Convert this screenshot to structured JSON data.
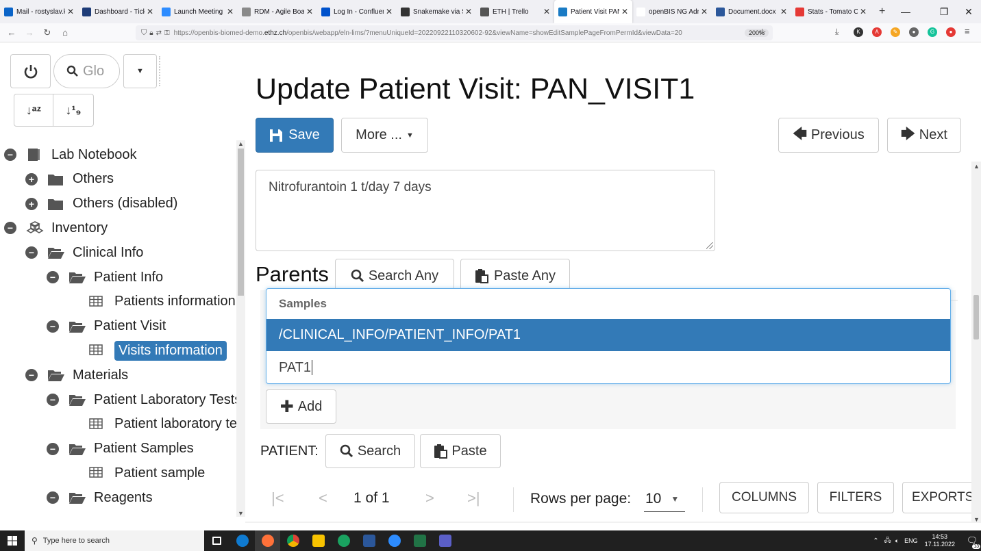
{
  "browser": {
    "tabs": [
      {
        "label": "Mail - rostyslav.ku",
        "color": "#0a64c8"
      },
      {
        "label": "Dashboard - Ticket",
        "color": "#1e3c78"
      },
      {
        "label": "Launch Meeting -",
        "color": "#2d8cff"
      },
      {
        "label": "RDM - Agile Board",
        "color": "#8a8a8a"
      },
      {
        "label": "Log In - Confluenc",
        "color": "#0052cc"
      },
      {
        "label": "Snakemake via SLU",
        "color": "#333333"
      },
      {
        "label": "ETH | Trello",
        "color": "#555555"
      },
      {
        "label": "Patient Visit PAN_V",
        "color": "#1a7bc4"
      },
      {
        "label": "openBIS NG Admin",
        "color": "#ffffff"
      },
      {
        "label": "Document.docx",
        "color": "#2b579a"
      },
      {
        "label": "Stats - Tomato Clo",
        "color": "#e53935"
      }
    ],
    "url_prefix": "https://openbis-biomed-demo.",
    "url_domain": "ethz.ch",
    "url_suffix": "/openbis/webapp/eln-lims/?menuUniqueId=20220922110320602-92&viewName=showEditSamplePageFromPermId&viewData=20",
    "zoom": "200%"
  },
  "left": {
    "search_placeholder": "Glo",
    "tree": [
      {
        "label": "Lab Notebook",
        "level": 0,
        "toggle": "minus",
        "icon": "notebook-icon"
      },
      {
        "label": "Others",
        "level": 1,
        "toggle": "plus",
        "icon": "folder-icon"
      },
      {
        "label": "Others (disabled)",
        "level": 1,
        "toggle": "plus",
        "icon": "folder-icon"
      },
      {
        "label": "Inventory",
        "level": 0,
        "toggle": "minus",
        "icon": "cubes-icon"
      },
      {
        "label": "Clinical Info",
        "level": 1,
        "toggle": "minus",
        "icon": "folder-open-icon"
      },
      {
        "label": "Patient Info",
        "level": 2,
        "toggle": "minus",
        "icon": "folder-open-icon"
      },
      {
        "label": "Patients information",
        "level": 3,
        "toggle": "",
        "icon": "table-icon"
      },
      {
        "label": "Patient Visit",
        "level": 2,
        "toggle": "minus",
        "icon": "folder-open-icon"
      },
      {
        "label": "Visits information",
        "level": 3,
        "toggle": "",
        "icon": "table-icon",
        "selected": true
      },
      {
        "label": "Materials",
        "level": 1,
        "toggle": "minus",
        "icon": "folder-open-icon"
      },
      {
        "label": "Patient Laboratory Tests",
        "level": 2,
        "toggle": "minus",
        "icon": "folder-open-icon"
      },
      {
        "label": "Patient laboratory tests",
        "level": 3,
        "toggle": "",
        "icon": "table-icon"
      },
      {
        "label": "Patient Samples",
        "level": 2,
        "toggle": "minus",
        "icon": "folder-open-icon"
      },
      {
        "label": "Patient sample",
        "level": 3,
        "toggle": "",
        "icon": "table-icon"
      },
      {
        "label": "Reagents",
        "level": 2,
        "toggle": "minus",
        "icon": "folder-open-icon"
      }
    ]
  },
  "main": {
    "title": "Update Patient Visit: PAN_VISIT1",
    "save_label": "Save",
    "more_label": "More ...",
    "previous_label": "Previous",
    "next_label": "Next",
    "notes_value": "Nitrofurantoin 1 t/day 7 days",
    "parents_label": "Parents",
    "search_any_label": "Search Any",
    "paste_any_label": "Paste Any",
    "dropdown": {
      "header": "Samples",
      "option": "/CLINICAL_INFO/PATIENT_INFO/PAT1",
      "input_value": "PAT1"
    },
    "add_label": "Add",
    "patient_label": "PATIENT:",
    "search_label": "Search",
    "paste_label": "Paste",
    "pager": {
      "page_text": "1 of 1",
      "rows_label": "Rows per page:",
      "rows_value": "10",
      "columns_label": "COLUMNS",
      "filters_label": "FILTERS",
      "exports_label": "EXPORTS"
    }
  },
  "taskbar": {
    "search_placeholder": "Type here to search",
    "lang": "ENG",
    "time": "14:53",
    "date": "17.11.2022",
    "notif_count": "13"
  }
}
